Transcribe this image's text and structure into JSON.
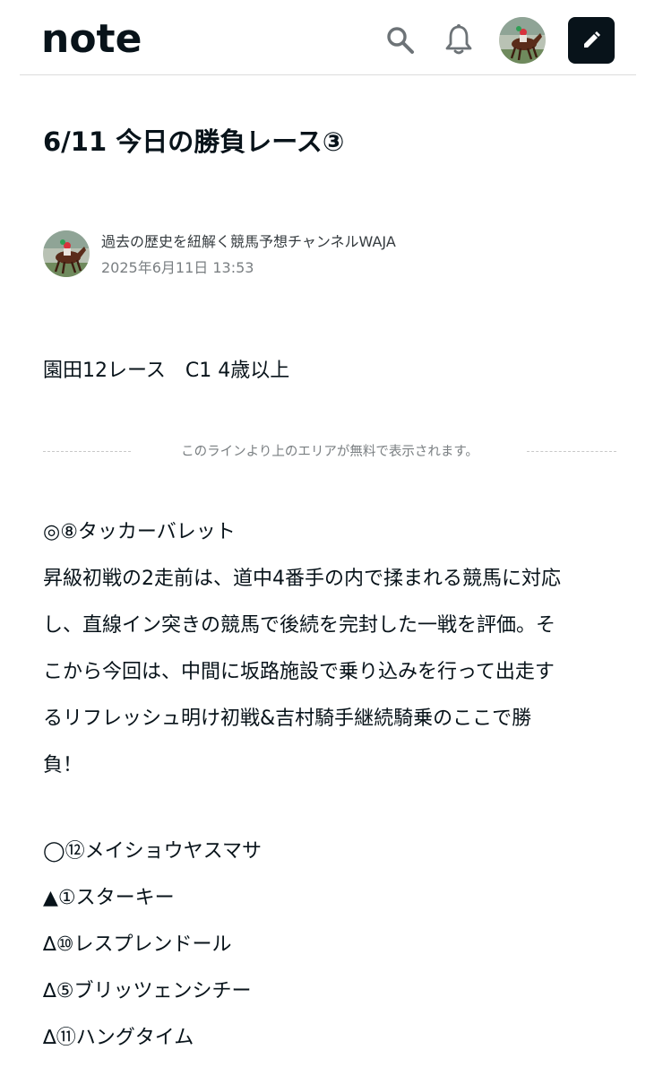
{
  "header": {
    "logo_text": "note",
    "icons": {
      "search": "search-icon",
      "notifications": "bell-icon",
      "post": "pencil-icon"
    }
  },
  "article": {
    "title": "6/11 今日の勝負レース③",
    "author": {
      "name": "過去の歴史を紐解く競馬予想チャンネルWAJA",
      "date": "2025年6月11日 13:53"
    },
    "race": "園田12レース　C1 4歳以上",
    "paywall_notice": "このラインより上のエリアが無料で表示されます。",
    "main_pick": {
      "label": "◎⑧タッカーバレット",
      "comment_lines": [
        "昇級初戦の2走前は、道中4番手の内で揉まれる競馬に対応",
        "し、直線イン突きの競馬で後続を完封した一戦を評価。そ",
        "こから今回は、中間に坂路施設で乗り込みを行って出走す",
        "るリフレッシュ明け初戦&吉村騎手継続騎乗のここで勝",
        "負！"
      ]
    },
    "other_picks": [
      "◯⑫メイショウヤスマサ",
      "▲①スターキー",
      "∆⑩レスプレンドール",
      "∆⑤ブリッツェンシチー",
      "∆⑪ハングタイム"
    ]
  }
}
